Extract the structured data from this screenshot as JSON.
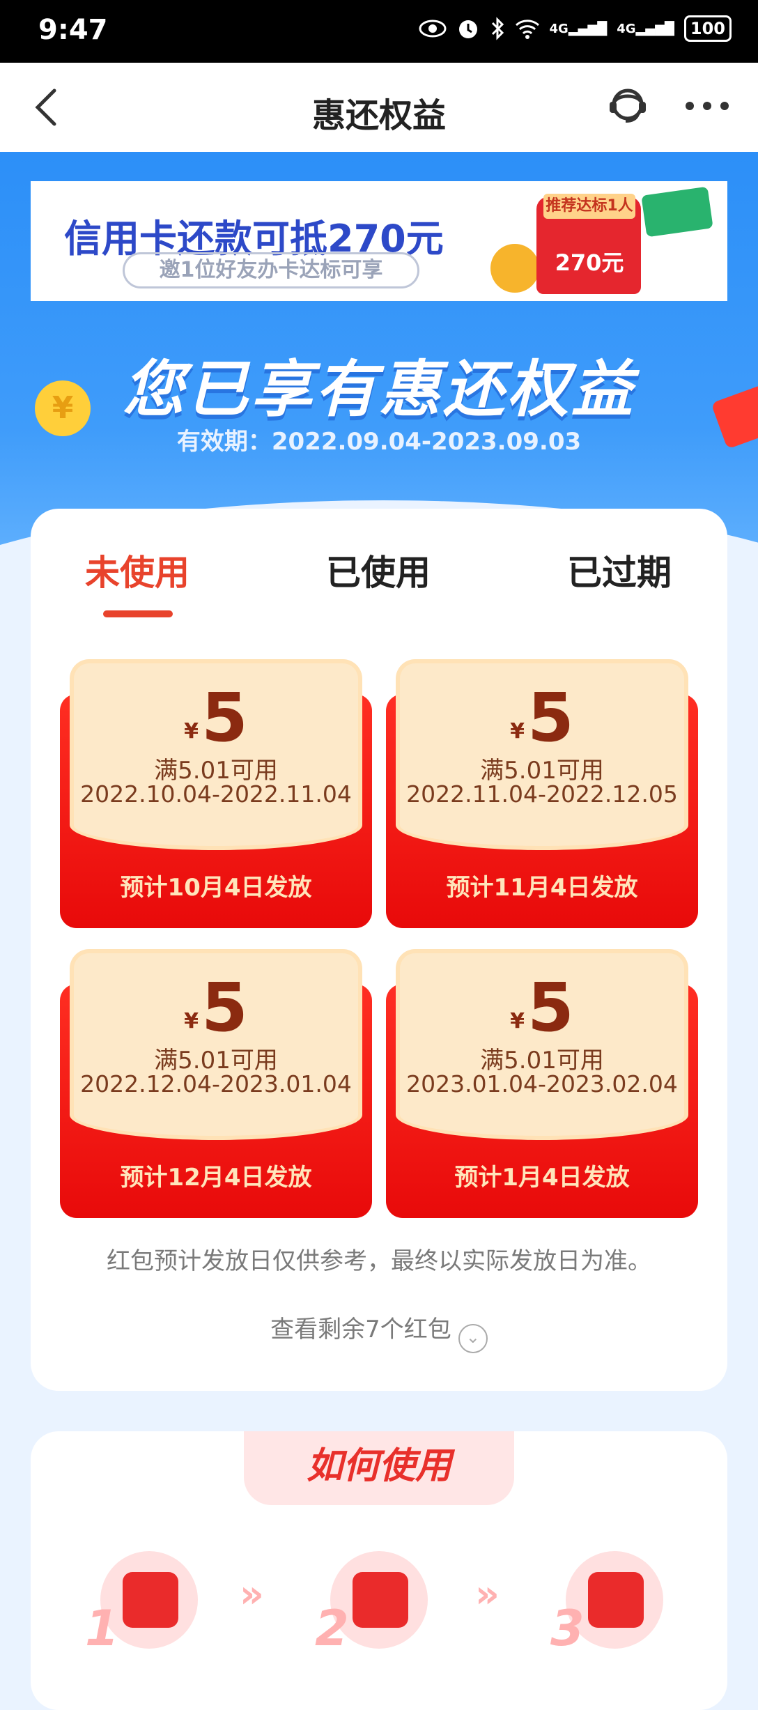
{
  "status_bar": {
    "time": "9:47",
    "battery": "100",
    "signal_1": "4G",
    "signal_2": "4G"
  },
  "nav": {
    "title": "惠还权益"
  },
  "banner": {
    "line1": "信用卡还款可抵270元",
    "line2": "邀1位好友办卡达标可享",
    "tag": "推荐达标1人",
    "amount": "270元"
  },
  "hero": {
    "headline": "您已享有惠还权益",
    "validity": "有效期：2022.09.04-2023.09.03",
    "coin_symbol": "¥"
  },
  "tabs": [
    {
      "label": "未使用"
    },
    {
      "label": "已使用"
    },
    {
      "label": "已过期"
    }
  ],
  "coupons": [
    {
      "currency": "¥",
      "amount": "5",
      "condition": "满5.01可用",
      "dates": "2022.10.04-2022.11.04",
      "issue": "预计10月4日发放"
    },
    {
      "currency": "¥",
      "amount": "5",
      "condition": "满5.01可用",
      "dates": "2022.11.04-2022.12.05",
      "issue": "预计11月4日发放"
    },
    {
      "currency": "¥",
      "amount": "5",
      "condition": "满5.01可用",
      "dates": "2022.12.04-2023.01.04",
      "issue": "预计12月4日发放"
    },
    {
      "currency": "¥",
      "amount": "5",
      "condition": "满5.01可用",
      "dates": "2023.01.04-2023.02.04",
      "issue": "预计1月4日发放"
    }
  ],
  "notice": "红包预计发放日仅供参考，最终以实际发放日为准。",
  "more_link": "查看剩余7个红包",
  "howto": {
    "title": "如何使用",
    "steps": [
      "1",
      "2",
      "3"
    ]
  },
  "colors": {
    "accent": "#e8432c",
    "hero_blue": "#2c8ff8",
    "coupon_red": "#ff2e22",
    "coupon_paper": "#fde9c9"
  }
}
